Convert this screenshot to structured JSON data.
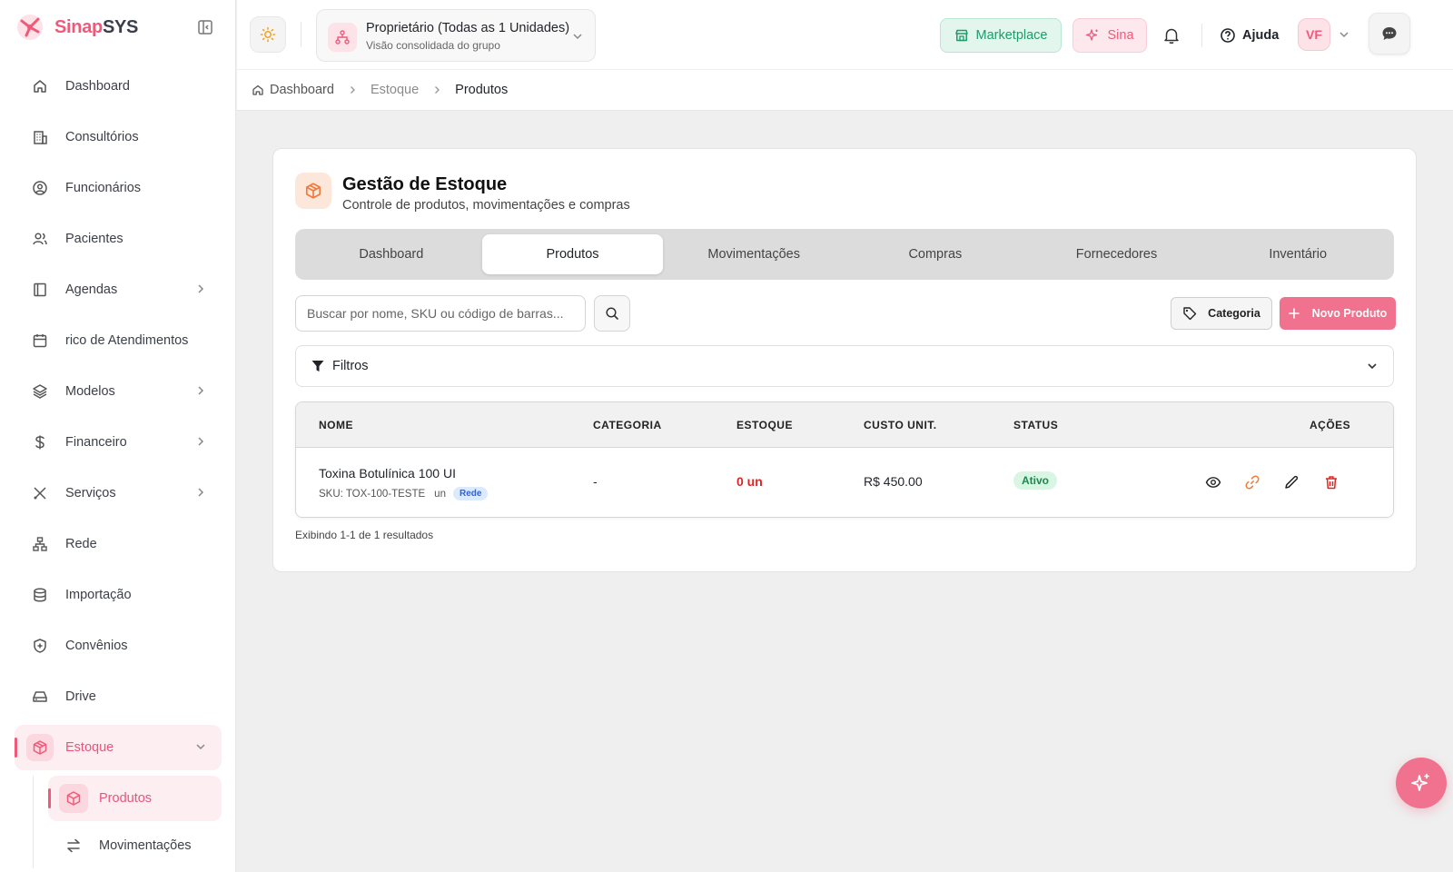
{
  "brand": {
    "name_part1": "Sinap",
    "name_part2": "SYS"
  },
  "sidebar": {
    "items": [
      {
        "label": "Dashboard",
        "icon": "home-icon"
      },
      {
        "label": "Consultórios",
        "icon": "building-icon"
      },
      {
        "label": "Funcionários",
        "icon": "user-circle-icon"
      },
      {
        "label": "Pacientes",
        "icon": "users-icon"
      },
      {
        "label": "Agendas",
        "icon": "book-icon",
        "has_children": true
      },
      {
        "label": "rico de Atendimentos",
        "icon": "calendar-icon"
      },
      {
        "label": "Modelos",
        "icon": "layers-icon",
        "has_children": true
      },
      {
        "label": "Financeiro",
        "icon": "dollar-icon",
        "has_children": true
      },
      {
        "label": "Serviços",
        "icon": "tools-icon",
        "has_children": true
      },
      {
        "label": "Rede",
        "icon": "network-icon"
      },
      {
        "label": "Importação",
        "icon": "database-icon"
      },
      {
        "label": "Convênios",
        "icon": "shield-plus-icon"
      },
      {
        "label": "Drive",
        "icon": "hard-drive-icon"
      },
      {
        "label": "Estoque",
        "icon": "package-icon",
        "active": true,
        "expanded": true
      }
    ],
    "subitems": [
      {
        "label": "Produtos",
        "icon": "package-icon",
        "active": true
      },
      {
        "label": "Movimentações",
        "icon": "arrows-swap-icon"
      }
    ]
  },
  "header": {
    "unit_title": "Proprietário (Todas as 1 Unidades)",
    "unit_subtitle": "Visão consolidada do grupo",
    "marketplace_label": "Marketplace",
    "sina_label": "Sina",
    "help_label": "Ajuda",
    "avatar_initials": "VF"
  },
  "breadcrumb": {
    "home": "Dashboard",
    "section": "Estoque",
    "current": "Produtos"
  },
  "page": {
    "title": "Gestão de Estoque",
    "subtitle": "Controle de produtos, movimentações e compras",
    "tabs": [
      "Dashboard",
      "Produtos",
      "Movimentações",
      "Compras",
      "Fornecedores",
      "Inventário"
    ],
    "active_tab": "Produtos"
  },
  "toolbar": {
    "search_placeholder": "Buscar por nome, SKU ou código de barras...",
    "category_label": "Categoria",
    "new_product_label": "Novo Produto",
    "filters_label": "Filtros"
  },
  "table": {
    "columns": [
      "NOME",
      "CATEGORIA",
      "ESTOQUE",
      "CUSTO UNIT.",
      "STATUS",
      "AÇÕES"
    ],
    "rows": [
      {
        "name": "Toxina Botulínica 100 UI",
        "sku": "SKU: TOX-100-TESTE",
        "unit": "un",
        "tag": "Rede",
        "category": "-",
        "stock": "0 un",
        "cost": "R$ 450.00",
        "status": "Ativo"
      }
    ]
  },
  "results_text": "Exibindo 1-1 de 1 resultados",
  "colors": {
    "accent": "#ef5a7a",
    "success": "#1f9a69",
    "danger": "#dc2626",
    "info": "#2563eb"
  }
}
